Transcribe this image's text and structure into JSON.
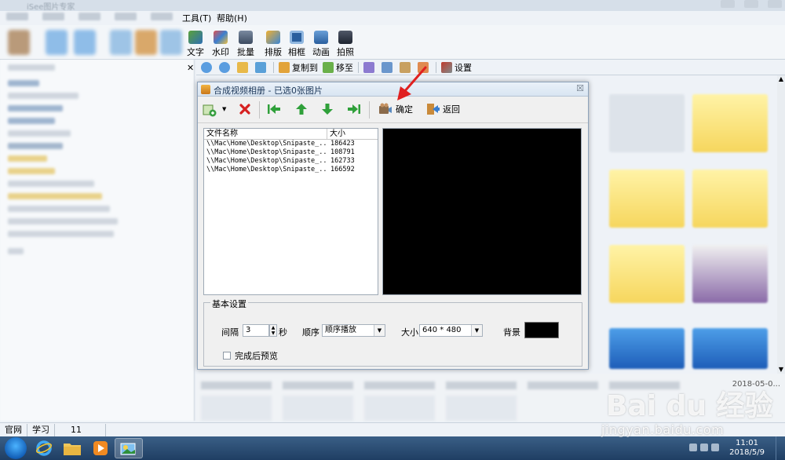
{
  "app": {
    "title": "iSee图片专家",
    "menu": {
      "tools": "工具(T)",
      "help": "帮助(H)"
    },
    "toolbar": [
      "文字",
      "水印",
      "批量",
      "排版",
      "相框",
      "动画",
      "拍照"
    ],
    "toolbar2": {
      "copy_to": "复制到",
      "move_to": "移至",
      "settings": "设置"
    },
    "status": [
      "官网",
      "学习",
      "11"
    ],
    "strip_date": "2018-05-0..."
  },
  "dialog": {
    "title": "合成视频相册 - 已选0张图片",
    "toolbar": {
      "confirm": "确定",
      "back": "返回"
    },
    "file_list": {
      "columns": [
        "文件名称",
        "大小"
      ],
      "rows": [
        {
          "name": "\\\\Mac\\Home\\Desktop\\Snipaste_...",
          "size": "186423"
        },
        {
          "name": "\\\\Mac\\Home\\Desktop\\Snipaste_...",
          "size": "108791"
        },
        {
          "name": "\\\\Mac\\Home\\Desktop\\Snipaste_...",
          "size": "162733"
        },
        {
          "name": "\\\\Mac\\Home\\Desktop\\Snipaste_...",
          "size": "166592"
        }
      ]
    },
    "basic_settings": {
      "legend": "基本设置",
      "interval_label": "间隔",
      "interval_value": "3",
      "interval_unit": "秒",
      "order_label": "顺序",
      "order_value": "顺序播放",
      "size_label": "大小",
      "size_value": "640 * 480",
      "bg_label": "背景",
      "bg_color": "#000000",
      "preview_after_label": "完成后预览",
      "preview_after_checked": false
    }
  },
  "taskbar": {
    "time": "11:01",
    "date": "2018/5/9"
  },
  "watermark": {
    "logo": "Bai du 经验",
    "url": "jingyan.baidu.com"
  },
  "colors": {
    "annotation_arrow": "#e02020",
    "taskbar": "#2b4d75"
  }
}
